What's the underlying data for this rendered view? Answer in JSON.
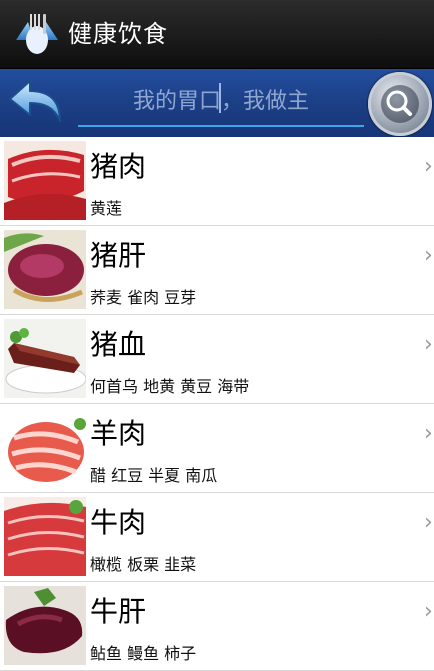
{
  "app": {
    "title": "健康饮食"
  },
  "search": {
    "placeholder": "我的胃口，我做主"
  },
  "colors": {
    "titlebar": "#1a1a1a",
    "searchbar": "#1e438c",
    "underline": "#3ea6e6"
  },
  "icons": {
    "back": "back-arrow-icon",
    "search": "search-icon",
    "chevron": "chevron-right-icon",
    "app": "tableware-icon"
  },
  "items": [
    {
      "name": "猪肉",
      "desc": "黄莲"
    },
    {
      "name": "猪肝",
      "desc": "荞麦 雀肉 豆芽"
    },
    {
      "name": "猪血",
      "desc": "何首乌 地黄 黄豆 海带"
    },
    {
      "name": "羊肉",
      "desc": "醋 红豆 半夏 南瓜"
    },
    {
      "name": "牛肉",
      "desc": "橄榄 板栗 韭菜"
    },
    {
      "name": "牛肝",
      "desc": "鲇鱼 鳗鱼 柿子"
    }
  ]
}
